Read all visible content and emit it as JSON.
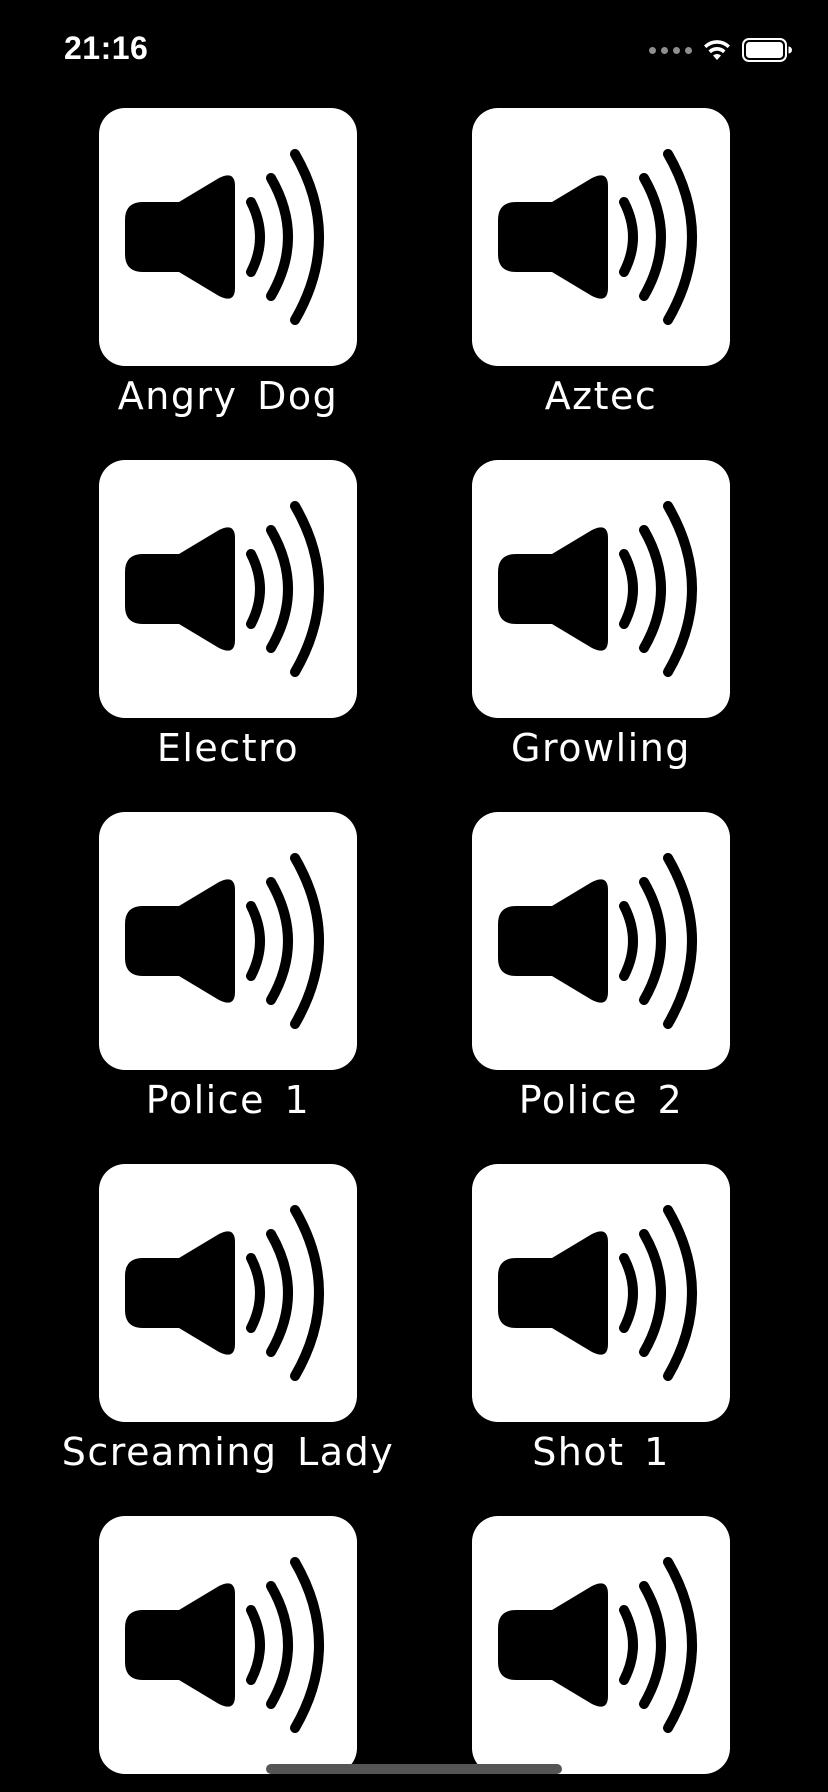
{
  "status_bar": {
    "time": "21:16",
    "icons": [
      "cellular-signal-icon",
      "wifi-icon",
      "battery-icon"
    ]
  },
  "sounds": [
    {
      "label": "Angry Dog",
      "icon": "speaker-icon"
    },
    {
      "label": "Aztec",
      "icon": "speaker-icon"
    },
    {
      "label": "Electro",
      "icon": "speaker-icon"
    },
    {
      "label": "Growling",
      "icon": "speaker-icon"
    },
    {
      "label": "Police 1",
      "icon": "speaker-icon"
    },
    {
      "label": "Police 2",
      "icon": "speaker-icon"
    },
    {
      "label": "Screaming Lady",
      "icon": "speaker-icon"
    },
    {
      "label": "Shot 1",
      "icon": "speaker-icon"
    },
    {
      "label": "",
      "icon": "speaker-icon"
    },
    {
      "label": "",
      "icon": "speaker-icon"
    }
  ],
  "colors": {
    "background": "#000000",
    "tile": "#ffffff",
    "text": "#ffffff"
  }
}
